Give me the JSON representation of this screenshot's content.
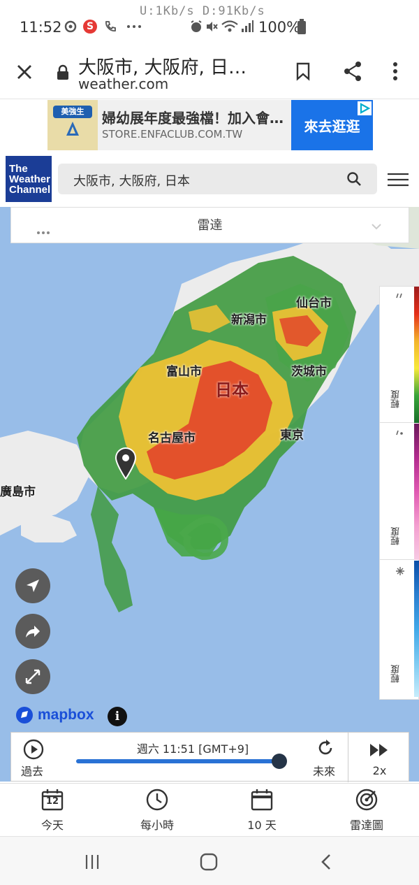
{
  "status_bar": {
    "time": "11:52",
    "net_speed": "U:1Kb/s    D:91Kb/s",
    "battery": "100%",
    "notification_badge": "S"
  },
  "browser": {
    "page_title": "大阪市, 大阪府, 日…",
    "domain": "weather.com"
  },
  "ad": {
    "brand_text": "美強生",
    "title": "婦幼展年度最強檔！加入會…",
    "url": "STORE.ENFACLUB.COM.TW",
    "cta": "來去逛逛"
  },
  "site": {
    "logo_text": "The Weather Channel",
    "search_value": "大阪市, 大阪府, 日本"
  },
  "map": {
    "layer_label": "雷達",
    "country_label": "日本",
    "cities": [
      {
        "name": "仙台市"
      },
      {
        "name": "新潟市"
      },
      {
        "name": "富山市"
      },
      {
        "name": "茨城市"
      },
      {
        "name": "名古屋市"
      },
      {
        "name": "東京"
      },
      {
        "name": "廣島市"
      }
    ],
    "attribution": "mapbox",
    "legend": [
      {
        "label": "輕度",
        "icon": "rain-icon",
        "colors": [
          "#9c1c1c",
          "#e52f1a",
          "#f3b42b",
          "#f7e93a",
          "#39a43a",
          "#1a6f2a"
        ]
      },
      {
        "label": "輕度",
        "icon": "mix-icon",
        "colors": [
          "#6a1a5a",
          "#b22b8e",
          "#e05ab2",
          "#f4a0d0",
          "#f7c9e3"
        ]
      },
      {
        "label": "輕度",
        "icon": "snow-icon",
        "colors": [
          "#0b4fa8",
          "#2a7fd0",
          "#41a8e8",
          "#7ecbf2",
          "#c7ecfb"
        ]
      }
    ]
  },
  "timeline": {
    "timestamp": "週六 11:51 [GMT+9]",
    "past_label": "過去",
    "future_label": "未來",
    "speed": "2x",
    "progress": 0.97
  },
  "bottom_nav": [
    {
      "label": "今天",
      "icon": "calendar-day-icon",
      "day": "12"
    },
    {
      "label": "每小時",
      "icon": "clock-icon"
    },
    {
      "label": "10 天",
      "icon": "calendar-icon"
    },
    {
      "label": "雷達圖",
      "icon": "radar-icon"
    }
  ],
  "colors": {
    "brand_blue": "#1b3d96",
    "water": "#98bde8",
    "timeline_track": "#2a72d5",
    "ad_cta": "#1a73e8"
  }
}
